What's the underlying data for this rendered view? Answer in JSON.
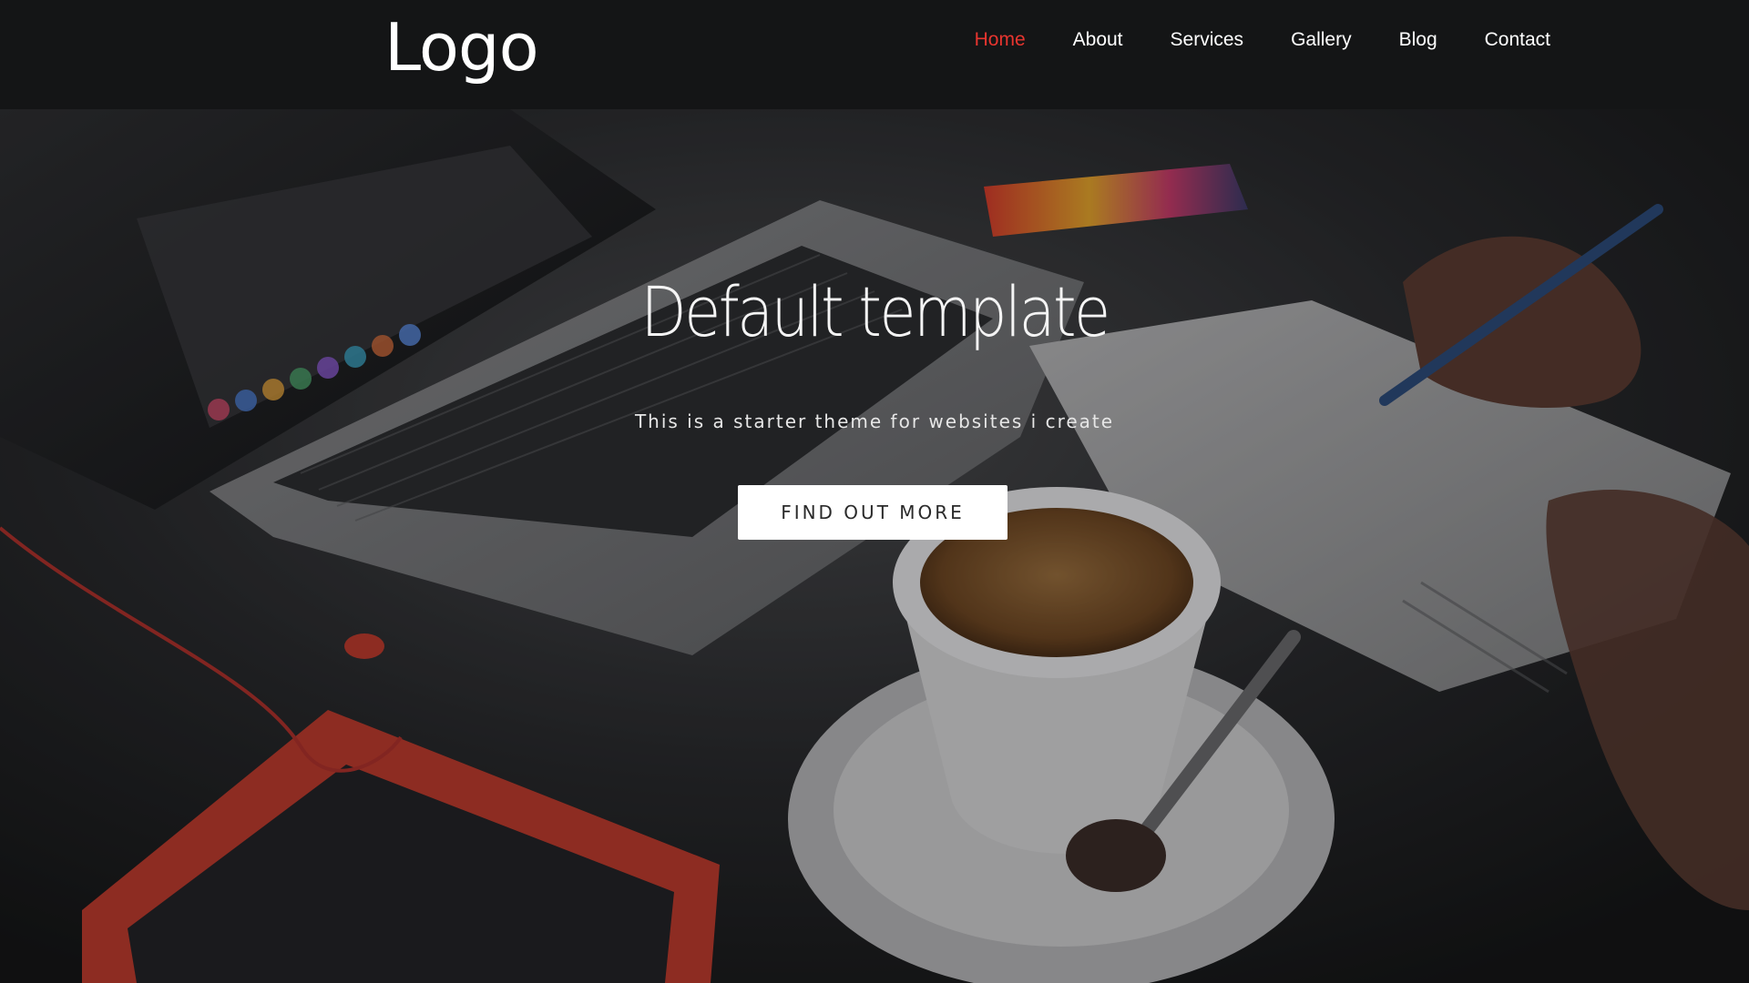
{
  "header": {
    "logo": "Logo",
    "nav": [
      {
        "label": "Home",
        "active": true
      },
      {
        "label": "About",
        "active": false
      },
      {
        "label": "Services",
        "active": false
      },
      {
        "label": "Gallery",
        "active": false
      },
      {
        "label": "Blog",
        "active": false
      },
      {
        "label": "Contact",
        "active": false
      }
    ]
  },
  "hero": {
    "title": "Default template",
    "subtitle": "This is a starter theme for websites i create",
    "cta_label": "FIND OUT MORE"
  },
  "colors": {
    "navbar_bg": "#141516",
    "active_nav": "#e8352f",
    "text": "#ffffff",
    "button_bg": "#ffffff",
    "button_text": "#2a2a2a"
  }
}
